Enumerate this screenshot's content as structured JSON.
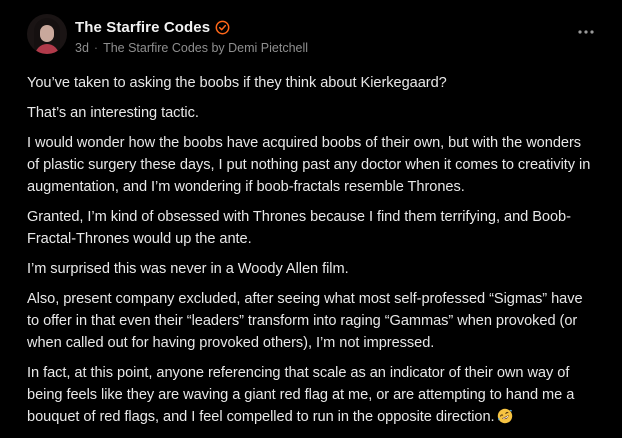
{
  "author": {
    "name": "The Starfire Codes",
    "verified_icon": "verified-check-icon",
    "timestamp": "3d",
    "publication": "The Starfire Codes by Demi Pietchell"
  },
  "colors": {
    "background": "#000000",
    "accent": "#ff6719",
    "text": "#e8e8e8",
    "muted": "#8f8f8f"
  },
  "menu": {
    "icon": "more-horizontal-icon"
  },
  "paragraphs": [
    "You’ve taken to asking the boobs if they think about Kierkegaard?",
    "That’s an interesting tactic.",
    "I would wonder how the boobs have acquired boobs of their own, but with the wonders of plastic surgery these days, I put nothing past any doctor when it comes to creativity in augmentation, and I’m wondering if boob-fractals resemble Thrones.",
    "Granted, I’m kind of obsessed with Thrones because I find them terrifying, and Boob-Fractal-Thrones would up the ante.",
    "I’m surprised this was never in a Woody Allen film.",
    "Also, present company excluded, after seeing what most self-professed “Sigmas” have to offer in that even their “leaders” transform into raging “Gammas” when provoked (or when called out for having provoked others), I’m not impressed.",
    "In fact, at this point, anyone referencing that scale as an indicator of their own way of being feels like they are waving a giant red flag at me, or are attempting to hand me a bouquet of red flags, and I feel compelled to run in the opposite direction."
  ],
  "trailing_emoji": "rolling-on-floor-laughing-emoji"
}
